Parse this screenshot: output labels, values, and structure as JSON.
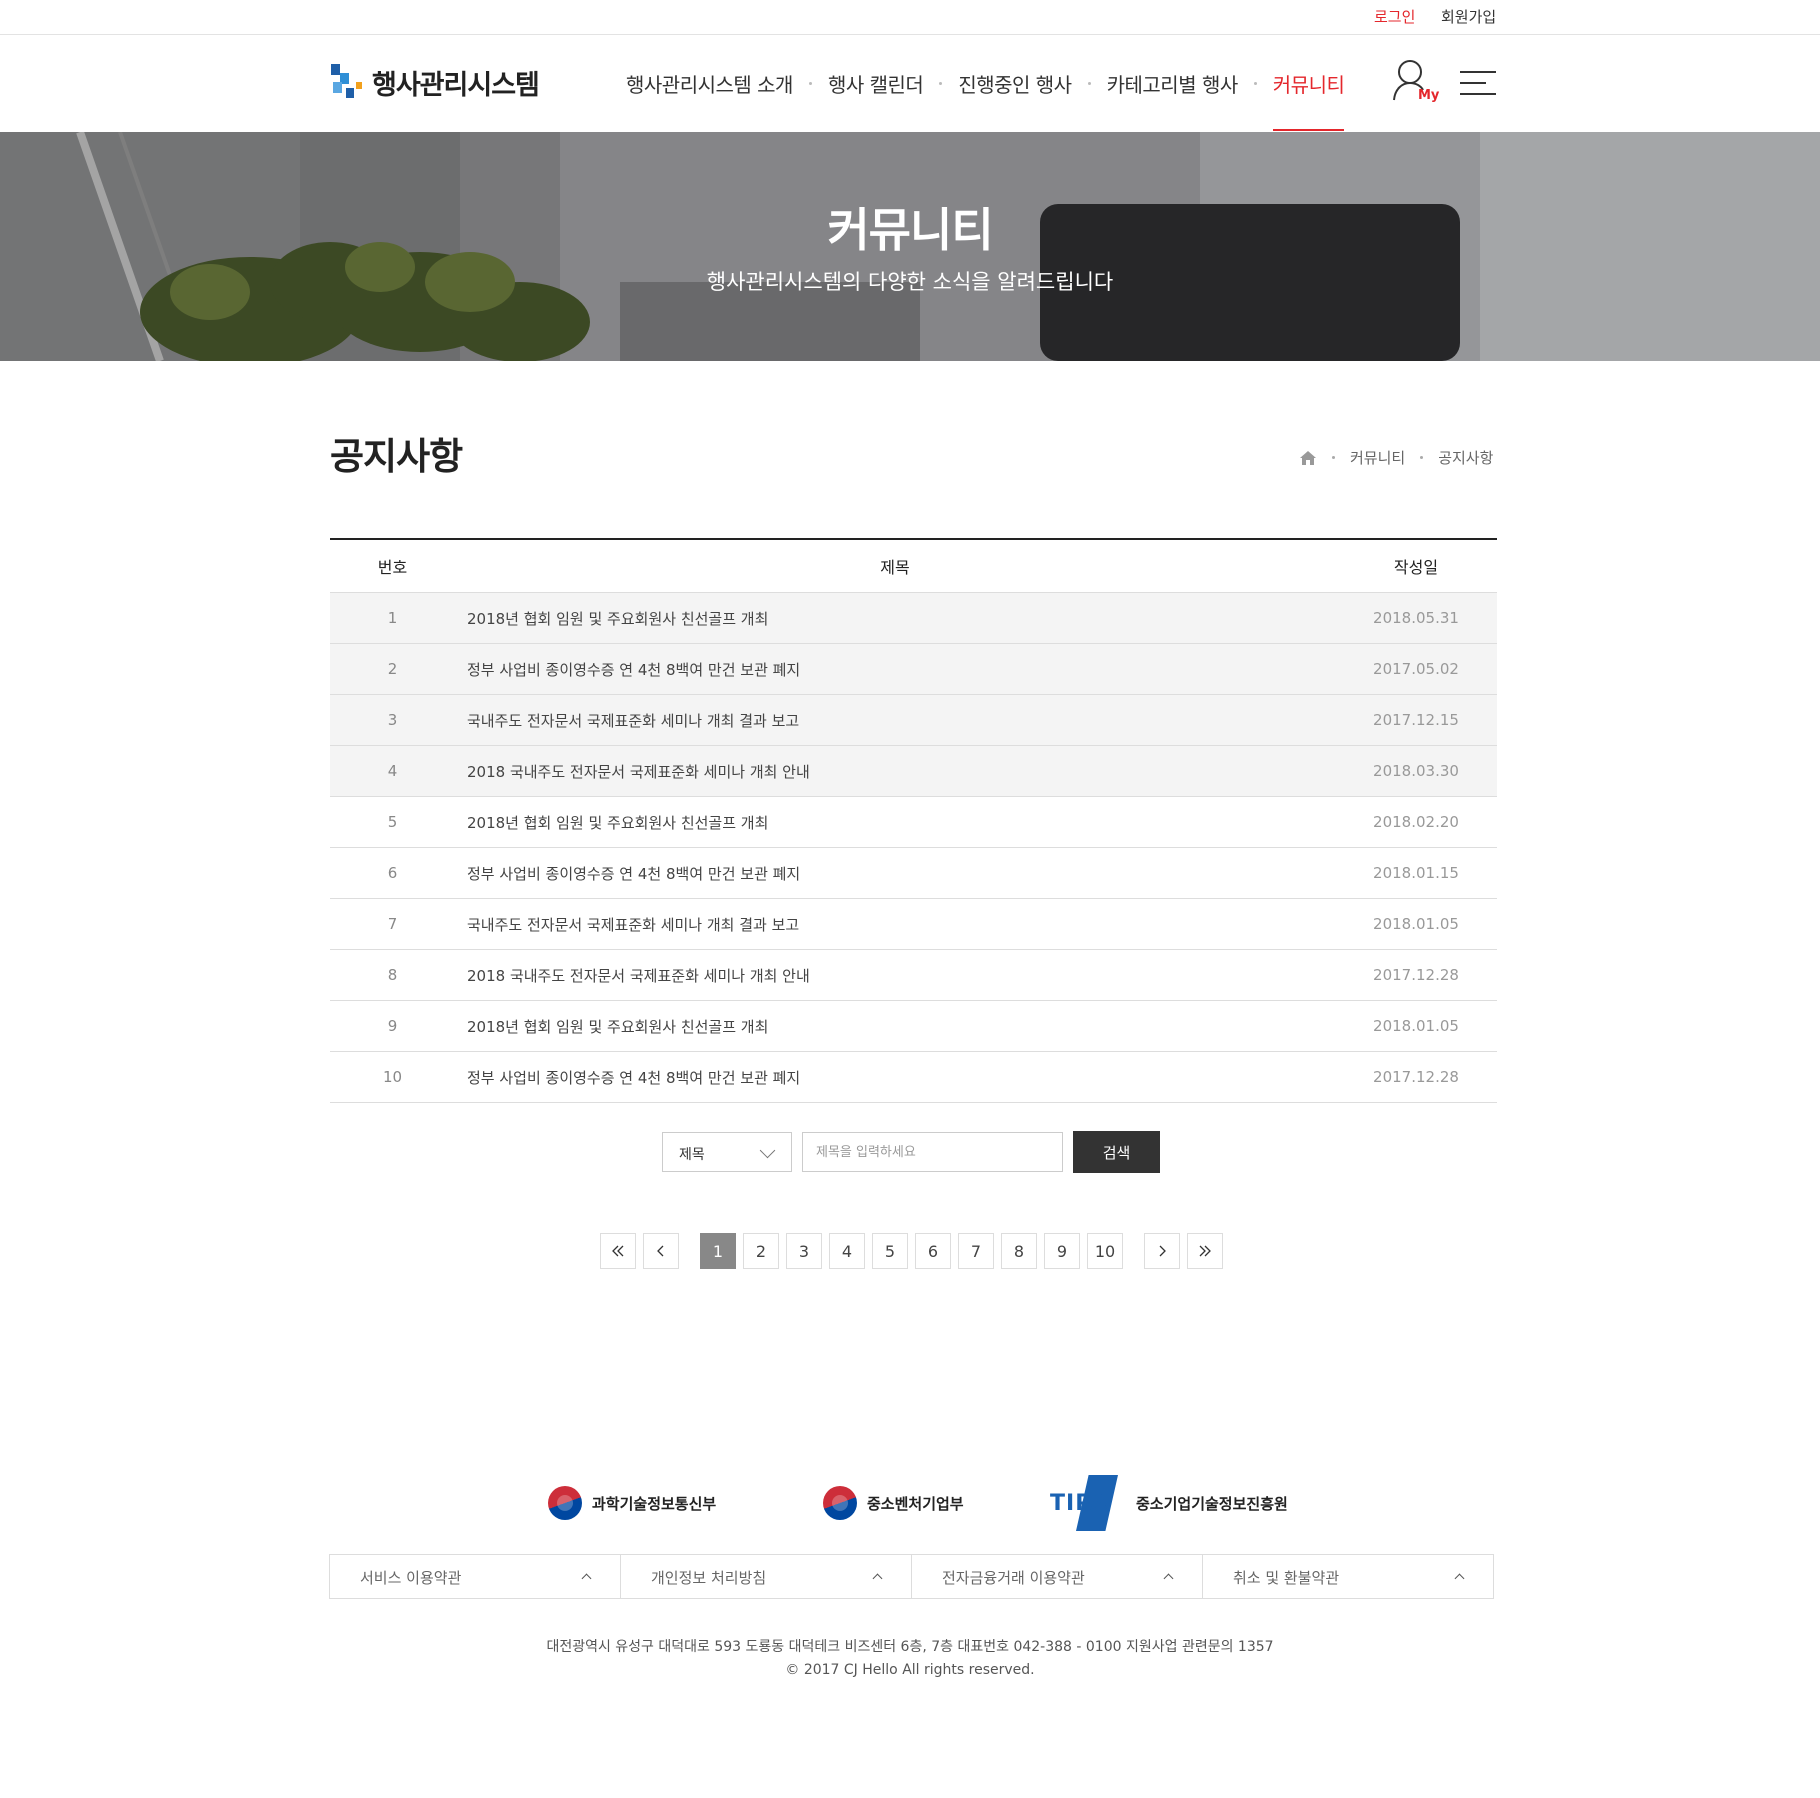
{
  "util": {
    "login": "로그인",
    "join": "회원가입"
  },
  "header": {
    "site_title": "행사관리시스템",
    "nav": [
      "행사관리시스템 소개",
      "행사 캘린더",
      "진행중인 행사",
      "카테고리별 행사",
      "커뮤니티"
    ],
    "active_nav": "커뮤니티",
    "my_label": "My"
  },
  "hero": {
    "title": "커뮤니티",
    "subtitle": "행사관리시스템의 다양한 소식을 알려드립니다"
  },
  "page": {
    "title": "공지사항"
  },
  "breadcrumb": {
    "level1": "커뮤니티",
    "level2": "공지사항"
  },
  "board": {
    "columns": {
      "no": "번호",
      "title": "제목",
      "date": "작성일"
    },
    "rows": [
      {
        "no": "1",
        "title": "2018년 협회 임원 및 주요회원사 친선골프 개최",
        "date": "2018.05.31"
      },
      {
        "no": "2",
        "title": "정부 사업비 종이영수증 연 4천 8백여 만건 보관 폐지",
        "date": "2017.05.02"
      },
      {
        "no": "3",
        "title": "국내주도 전자문서 국제표준화 세미나 개최 결과 보고",
        "date": "2017.12.15"
      },
      {
        "no": "4",
        "title": "2018 국내주도 전자문서 국제표준화 세미나 개최 안내",
        "date": "2018.03.30"
      },
      {
        "no": "5",
        "title": "2018년 협회 임원 및 주요회원사 친선골프 개최",
        "date": "2018.02.20"
      },
      {
        "no": "6",
        "title": "정부 사업비 종이영수증 연 4천 8백여 만건 보관 폐지",
        "date": "2018.01.15"
      },
      {
        "no": "7",
        "title": "국내주도 전자문서 국제표준화 세미나 개최 결과 보고",
        "date": "2018.01.05"
      },
      {
        "no": "8",
        "title": "2018 국내주도 전자문서 국제표준화 세미나 개최 안내",
        "date": "2017.12.28"
      },
      {
        "no": "9",
        "title": "2018년 협회 임원 및 주요회원사 친선골프 개최",
        "date": "2018.01.05"
      },
      {
        "no": "10",
        "title": "정부 사업비 종이영수증 연 4천 8백여 만건 보관 폐지",
        "date": "2017.12.28"
      }
    ]
  },
  "search": {
    "select_value": "제목",
    "placeholder": "제목을 입력하세요",
    "button": "검색"
  },
  "pagination": {
    "pages": [
      "1",
      "2",
      "3",
      "4",
      "5",
      "6",
      "7",
      "8",
      "9",
      "10"
    ],
    "current": "1"
  },
  "footer": {
    "logos": [
      "과학기술정보통신부",
      "중소벤처기업부",
      "중소기업기술정보진흥원"
    ],
    "tipa_text": "TIPA",
    "terms": [
      "서비스 이용약관",
      "개인정보 처리방침",
      "전자금융거래 이용약관",
      "취소 및 환불약관"
    ],
    "address": "대전광역시 유성구 대덕대로 593 도룡동  대덕테크 비즈센터 6층, 7층  대표번호 042-388 - 0100  지원사업 관련문의 1357",
    "copyright": "© 2017 CJ Hello All rights reserved."
  },
  "colors": {
    "accent": "#e4272c",
    "dark_button": "#333333",
    "row_shade": "#f4f4f4",
    "tipa_blue": "#1a62b2"
  },
  "icons": [
    "logo-mark-icon",
    "user-my-icon",
    "hamburger-menu-icon",
    "home-icon",
    "chevron-down-icon",
    "first-page-icon",
    "prev-page-icon",
    "next-page-icon",
    "last-page-icon",
    "caret-up-icon"
  ]
}
